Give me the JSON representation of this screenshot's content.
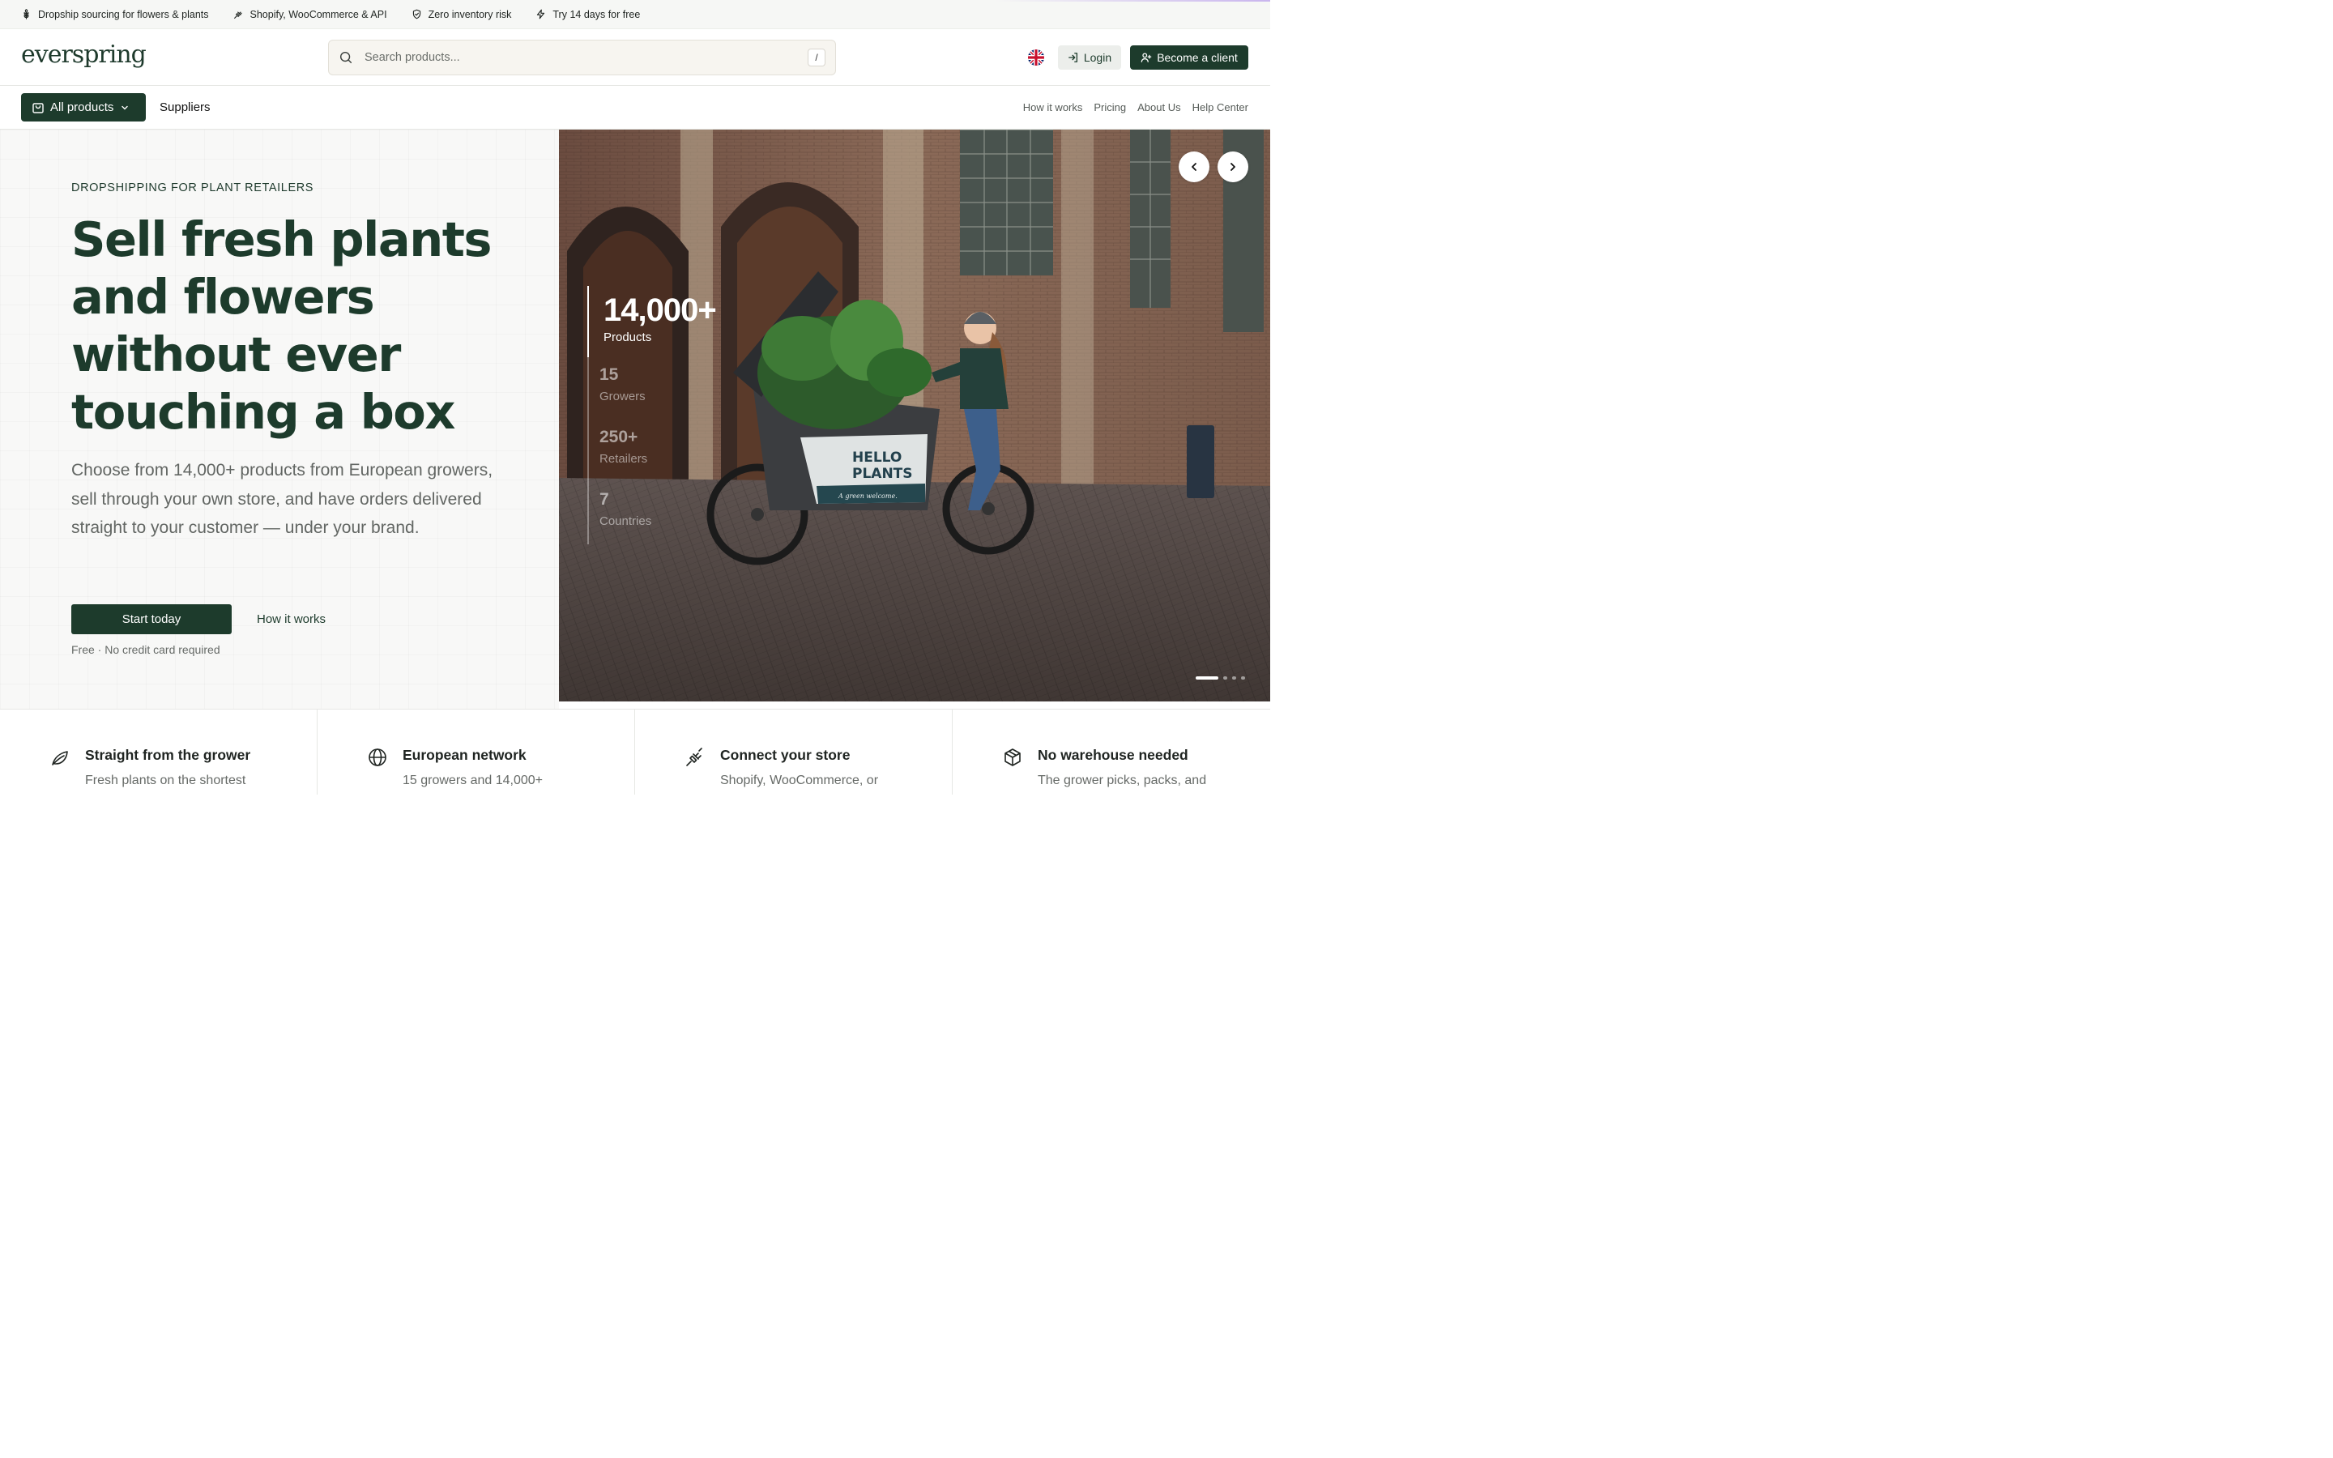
{
  "topbar": {
    "items": [
      {
        "icon": "wheat-icon",
        "text": "Dropship sourcing for flowers & plants"
      },
      {
        "icon": "plug-icon",
        "text": "Shopify, WooCommerce & API"
      },
      {
        "icon": "shield-check-icon",
        "text": "Zero inventory risk"
      },
      {
        "icon": "lightning-icon",
        "text": "Try 14 days for free"
      }
    ]
  },
  "header": {
    "logo": "everspring",
    "search_placeholder": "Search products...",
    "search_shortcut": "/",
    "language_icon": "uk-flag-icon",
    "login_label": "Login",
    "client_label": "Become a client"
  },
  "nav": {
    "all_products": "All products",
    "suppliers": "Suppliers",
    "links": [
      "How it works",
      "Pricing",
      "About Us",
      "Help Center"
    ]
  },
  "hero": {
    "eyebrow": "DROPSHIPPING FOR PLANT RETAILERS",
    "title": "Sell fresh plants and flowers without ever touching a box",
    "subtitle": "Choose from 14,000+ products from European growers, sell through your own store, and have orders delivered straight to your customer — under your brand.",
    "cta_primary": "Start today",
    "cta_secondary": "How it works",
    "note": "Free · No credit card required",
    "image_sign_line1": "HELLO",
    "image_sign_line2": "PLANTS",
    "image_sign_tagline": "A green welcome.",
    "stats": [
      {
        "value": "14,000+",
        "label": "Products"
      },
      {
        "value": "15",
        "label": "Growers"
      },
      {
        "value": "250+",
        "label": "Retailers"
      },
      {
        "value": "7",
        "label": "Countries"
      }
    ],
    "carousel_slide_count": 4,
    "carousel_active": 1
  },
  "features": [
    {
      "icon": "leaf-icon",
      "title": "Straight from the grower",
      "desc": "Fresh plants on the shortest"
    },
    {
      "icon": "globe-icon",
      "title": "European network",
      "desc": "15 growers and 14,000+"
    },
    {
      "icon": "plug-icon",
      "title": "Connect your store",
      "desc": "Shopify, WooCommerce, or"
    },
    {
      "icon": "box-icon",
      "title": "No warehouse needed",
      "desc": "The grower picks, packs, and"
    }
  ],
  "colors": {
    "brand_green": "#1d3b2c",
    "muted_text": "#626663"
  }
}
